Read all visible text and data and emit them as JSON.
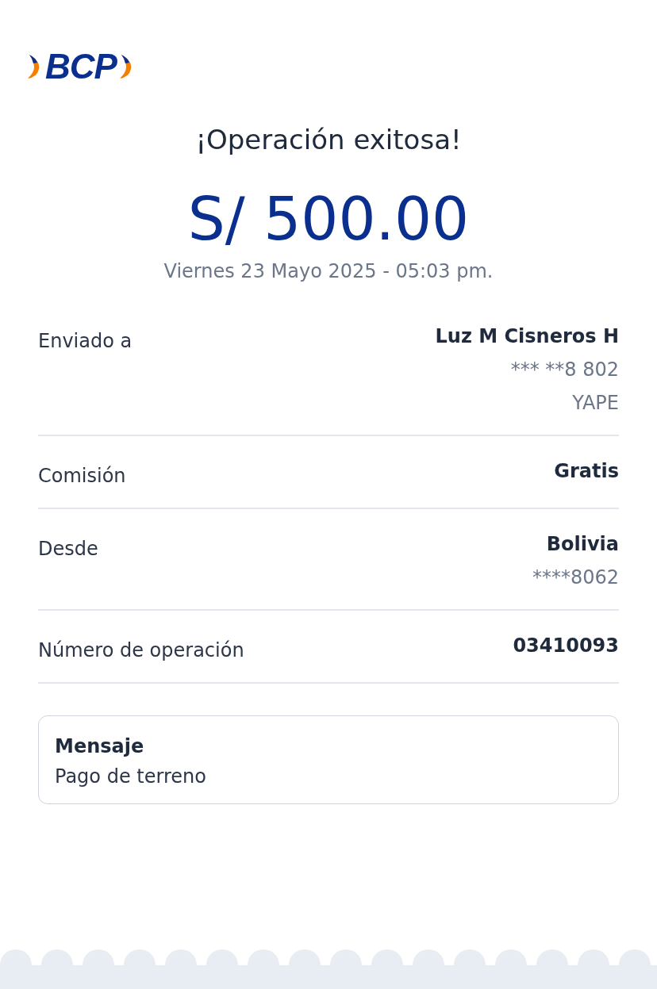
{
  "logo": {
    "text": "BCP"
  },
  "title": "¡Operación exitosa!",
  "amount": "S/ 500.00",
  "date": "Viernes 23 Mayo 2025 - 05:03 pm.",
  "details": [
    {
      "label": "Enviado a",
      "values": [
        "Luz M Cisneros H",
        "*** **8 802",
        "YAPE"
      ]
    },
    {
      "label": "Comisión",
      "values": [
        "Gratis"
      ]
    },
    {
      "label": "Desde",
      "values": [
        "Bolivia",
        "****8062"
      ]
    },
    {
      "label": "Número de operación",
      "values": [
        "03410093"
      ]
    }
  ],
  "message": {
    "title": "Mensaje",
    "text": "Pago de terreno"
  }
}
